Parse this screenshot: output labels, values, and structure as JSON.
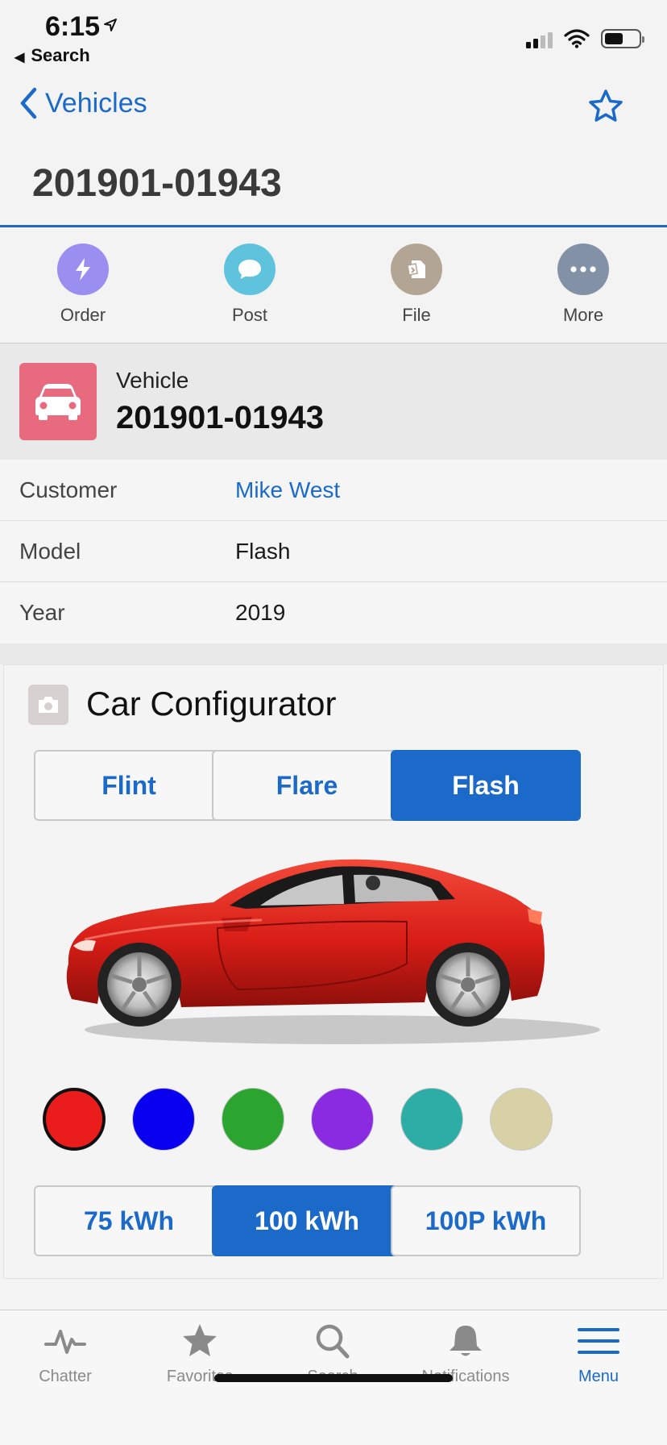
{
  "status_bar": {
    "time": "6:15",
    "back_label": "Search"
  },
  "nav": {
    "back_label": "Vehicles"
  },
  "page_title": "201901-01943",
  "actions": [
    {
      "label": "Order",
      "icon": "lightning-icon",
      "color": "#9a8ef0"
    },
    {
      "label": "Post",
      "icon": "chat-bubble-icon",
      "color": "#5fc3dd"
    },
    {
      "label": "File",
      "icon": "file-icon",
      "color": "#b3a594"
    },
    {
      "label": "More",
      "icon": "ellipsis-icon",
      "color": "#8391a6"
    }
  ],
  "record": {
    "type_label": "Vehicle",
    "name": "201901-01943",
    "icon": "car-icon",
    "icon_color": "#e86a7f"
  },
  "fields": [
    {
      "label": "Customer",
      "value": "Mike West",
      "is_link": true
    },
    {
      "label": "Model",
      "value": "Flash",
      "is_link": false
    },
    {
      "label": "Year",
      "value": "2019",
      "is_link": false
    }
  ],
  "configurator": {
    "title": "Car Configurator",
    "models": [
      {
        "label": "Flint",
        "selected": false
      },
      {
        "label": "Flare",
        "selected": false
      },
      {
        "label": "Flash",
        "selected": true
      }
    ],
    "colors": [
      {
        "name": "red",
        "hex": "#ea1c1c",
        "selected": true
      },
      {
        "name": "blue",
        "hex": "#0a00f0",
        "selected": false
      },
      {
        "name": "green",
        "hex": "#2ba52f",
        "selected": false
      },
      {
        "name": "purple",
        "hex": "#8a2be2",
        "selected": false
      },
      {
        "name": "teal",
        "hex": "#2eada7",
        "selected": false
      },
      {
        "name": "beige",
        "hex": "#d9d1a6",
        "selected": false
      }
    ],
    "batteries": [
      {
        "label": "75 kWh",
        "selected": false
      },
      {
        "label": "100 kWh",
        "selected": true
      },
      {
        "label": "100P kWh",
        "selected": false
      }
    ]
  },
  "tabbar": [
    {
      "label": "Chatter",
      "icon": "pulse-icon",
      "active": false
    },
    {
      "label": "Favorites",
      "icon": "star-icon",
      "active": false
    },
    {
      "label": "Search",
      "icon": "search-icon",
      "active": false
    },
    {
      "label": "Notifications",
      "icon": "bell-icon",
      "active": false
    },
    {
      "label": "Menu",
      "icon": "hamburger-icon",
      "active": true
    }
  ],
  "accent_color": "#1b6ac9"
}
